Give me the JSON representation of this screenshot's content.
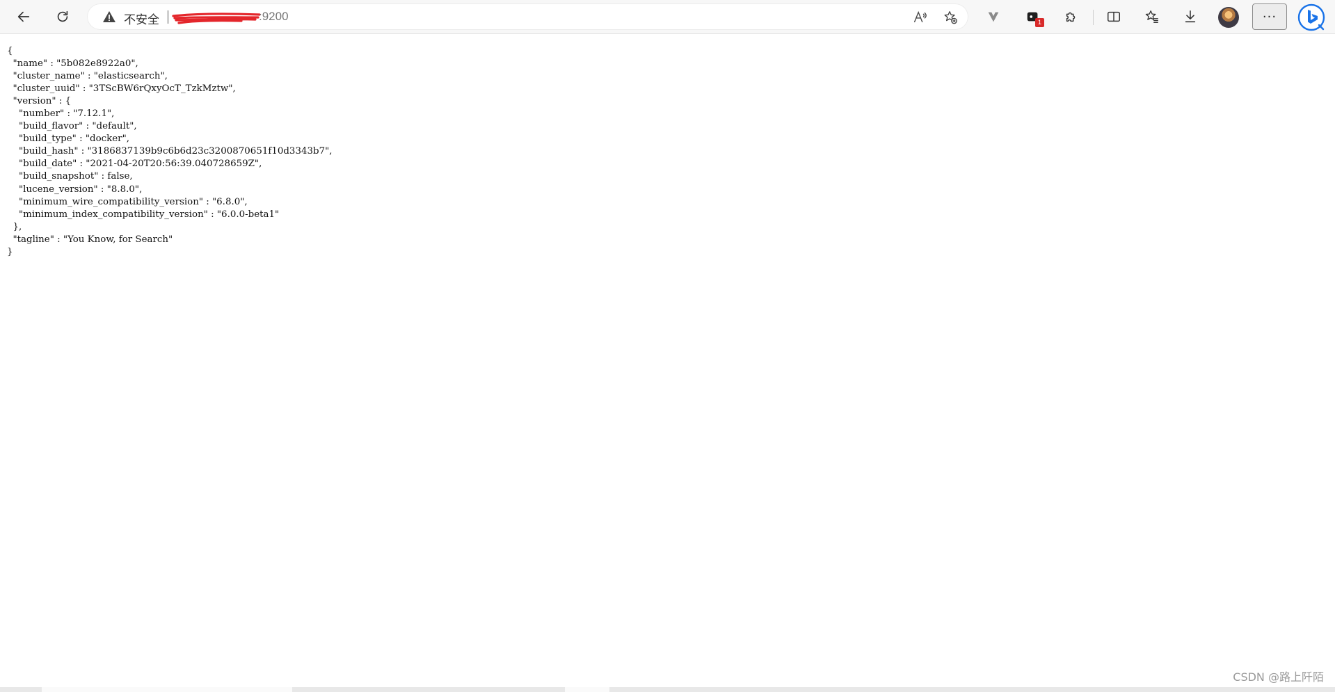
{
  "toolbar": {
    "back_icon": "arrow-left-icon",
    "refresh_icon": "refresh-icon",
    "security_label": "不安全",
    "url_port": ":9200",
    "read_aloud_icon": "read-aloud-icon",
    "favorite_add_icon": "star-plus-icon",
    "extension_v_icon": "v-extension-icon",
    "extension_badge_count": "1",
    "extensions_icon": "puzzle-icon",
    "split_screen_icon": "split-screen-icon",
    "favorites_icon": "favorites-icon",
    "downloads_icon": "download-icon",
    "more_label": "···",
    "bing_icon": "bing-copilot-icon",
    "accent_blue": "#1a73e8",
    "badge_red": "#d82a2a"
  },
  "json_lines": [
    "{",
    "  \"name\" : \"5b082e8922a0\",",
    "  \"cluster_name\" : \"elasticsearch\",",
    "  \"cluster_uuid\" : \"3TScBW6rQxyOcT_TzkMztw\",",
    "  \"version\" : {",
    "    \"number\" : \"7.12.1\",",
    "    \"build_flavor\" : \"default\",",
    "    \"build_type\" : \"docker\",",
    "    \"build_hash\" : \"3186837139b9c6b6d23c3200870651f10d3343b7\",",
    "    \"build_date\" : \"2021-04-20T20:56:39.040728659Z\",",
    "    \"build_snapshot\" : false,",
    "    \"lucene_version\" : \"8.8.0\",",
    "    \"minimum_wire_compatibility_version\" : \"6.8.0\",",
    "    \"minimum_index_compatibility_version\" : \"6.0.0-beta1\"",
    "  },",
    "  \"tagline\" : \"You Know, for Search\"",
    "}"
  ],
  "watermark": "CSDN @路上阡陌"
}
